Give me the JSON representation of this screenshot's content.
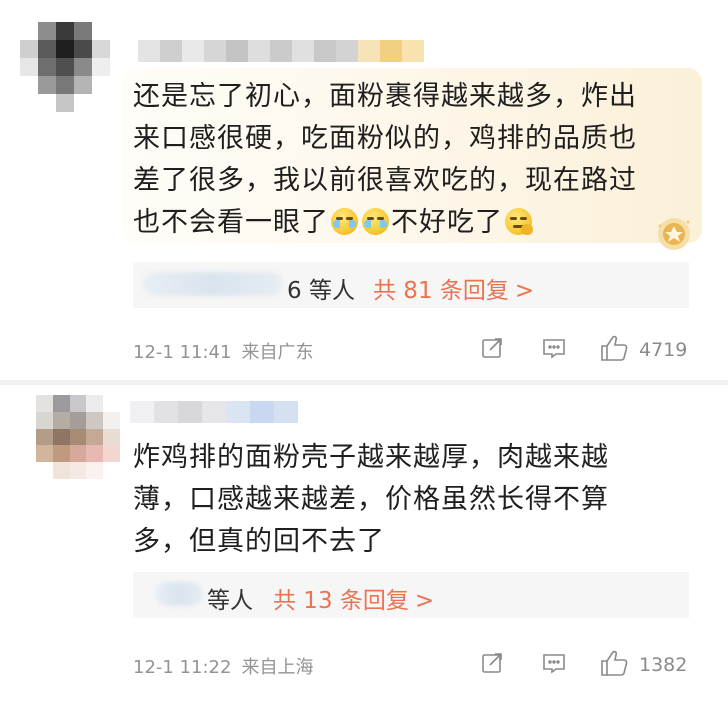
{
  "comments": [
    {
      "text_line1": "还是忘了初心，面粉裹得越来越多，炸出",
      "text_line2": "来口感很硬，吃面粉似的，鸡排的品质也",
      "text_line3": "差了很多，我以前很喜欢吃的，现在路过",
      "text_line4a": "也不会看一眼了",
      "text_line4b": "不好吃了",
      "emojis": [
        "cry-laugh-emoji",
        "cry-laugh-emoji",
        "thinking-emoji"
      ],
      "reply_suffix": "6 等人",
      "reply_link": "共 81 条回复",
      "reply_arrow": ">",
      "timestamp": "12-1 11:41",
      "location": "来自广东",
      "likes": "4719"
    },
    {
      "text_line1": "炸鸡排的面粉壳子越来越厚，肉越来越",
      "text_line2": "薄，口感越来越差，价格虽然长得不算",
      "text_line3": "多，但真的回不去了",
      "reply_suffix": "等人",
      "reply_link": "共 13 条回复",
      "reply_arrow": ">",
      "timestamp": "12-1 11:22",
      "location": "来自上海",
      "likes": "1382"
    }
  ],
  "colors": {
    "link": "#eb7350",
    "meta": "#939393",
    "bubble": "#fdf6e7"
  }
}
